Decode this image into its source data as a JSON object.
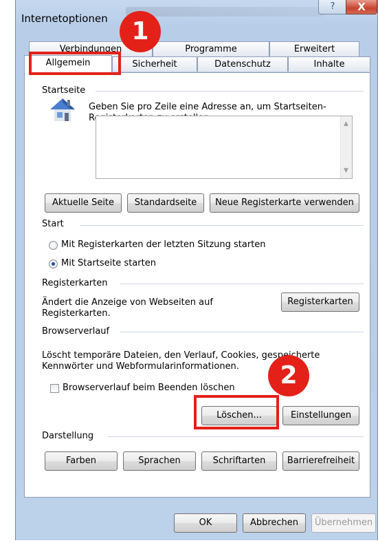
{
  "window": {
    "title": "Internetoptionen",
    "help_glyph": "?",
    "close_glyph": "X"
  },
  "tabs": {
    "row1": [
      "Verbindungen",
      "Programme",
      "Erweitert"
    ],
    "row2": [
      "Allgemein",
      "Sicherheit",
      "Datenschutz",
      "Inhalte"
    ]
  },
  "homepage": {
    "section": "Startseite",
    "description": "Geben Sie pro Zeile eine Adresse an, um Startseiten-Registerkarten zu erstellen.",
    "textarea_value": "",
    "buttons": [
      "Aktuelle Seite",
      "Standardseite",
      "Neue Registerkarte verwenden"
    ]
  },
  "start": {
    "section": "Start",
    "options": [
      {
        "label": "Mit Registerkarten der letzten Sitzung starten",
        "checked": false
      },
      {
        "label": "Mit Startseite starten",
        "checked": true
      }
    ]
  },
  "tabs_section": {
    "section": "Registerkarten",
    "description": "Ändert die Anzeige von Webseiten auf Registerkarten.",
    "button": "Registerkarten"
  },
  "history": {
    "section": "Browserverlauf",
    "description": "Löscht temporäre Dateien, den Verlauf, Cookies, gespeicherte Kennwörter und Webformularinformationen.",
    "checkbox_label": "Browserverlauf beim Beenden löschen",
    "checkbox_checked": false,
    "delete_button": "Löschen...",
    "settings_button": "Einstellungen"
  },
  "appearance": {
    "section": "Darstellung",
    "buttons": [
      "Farben",
      "Sprachen",
      "Schriftarten",
      "Barrierefreiheit"
    ]
  },
  "footer": {
    "ok": "OK",
    "cancel": "Abbrechen",
    "apply": "Übernehmen",
    "apply_enabled": false
  },
  "annotations": {
    "marker1": "1",
    "marker2": "2",
    "color": "#e32119"
  }
}
